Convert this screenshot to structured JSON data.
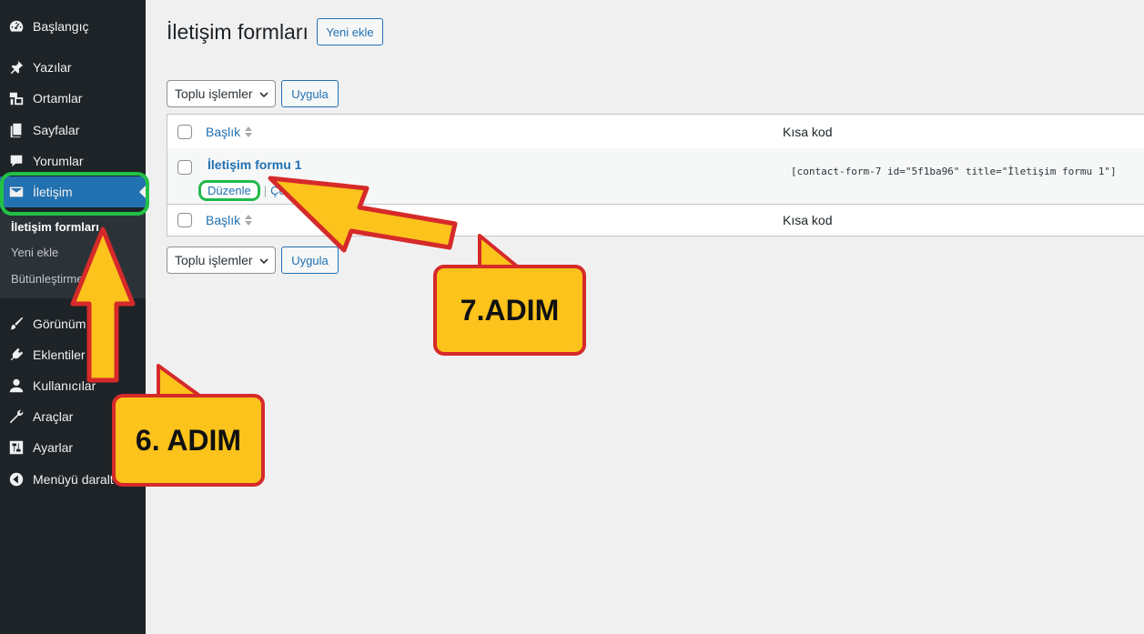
{
  "sidebar": {
    "items": [
      {
        "label": "Başlangıç",
        "icon": "dashboard-icon"
      },
      {
        "label": "Yazılar",
        "icon": "pin-icon"
      },
      {
        "label": "Ortamlar",
        "icon": "media-icon"
      },
      {
        "label": "Sayfalar",
        "icon": "page-icon"
      },
      {
        "label": "Yorumlar",
        "icon": "comment-icon"
      },
      {
        "label": "İletişim",
        "icon": "mail-icon",
        "active": true
      },
      {
        "label": "Görünüm",
        "icon": "brush-icon"
      },
      {
        "label": "Eklentiler",
        "icon": "plugin-icon"
      },
      {
        "label": "Kullanıcılar",
        "icon": "user-icon"
      },
      {
        "label": "Araçlar",
        "icon": "wrench-icon"
      },
      {
        "label": "Ayarlar",
        "icon": "settings-icon"
      },
      {
        "label": "Menüyü daralt",
        "icon": "collapse-icon"
      }
    ],
    "submenu": [
      "İletişim formları",
      "Yeni ekle",
      "Bütünleştirme"
    ]
  },
  "main": {
    "title": "İletişim formları",
    "add_new": "Yeni ekle",
    "bulk_actions": "Toplu işlemler",
    "apply": "Uygula",
    "columns": {
      "title": "Başlık",
      "shortcode": "Kısa kod"
    },
    "rows": [
      {
        "title": "İletişim formu 1",
        "edit": "Düzenle",
        "separator": "|",
        "duplicate": "Çoğalt",
        "shortcode": "[contact-form-7 id=\"5f1ba96\" title=\"İletişim formu 1\"]"
      }
    ]
  },
  "annotations": {
    "step6": "6. ADIM",
    "step7": "7.ADIM",
    "colors": {
      "callout_fill": "#fbc31c",
      "callout_border": "#d62a2a",
      "highlight": "#22c145"
    }
  },
  "colors": {
    "sidebar_bg": "#1d2327",
    "accent": "#2271b1",
    "page_bg": "#f0f0f1"
  }
}
